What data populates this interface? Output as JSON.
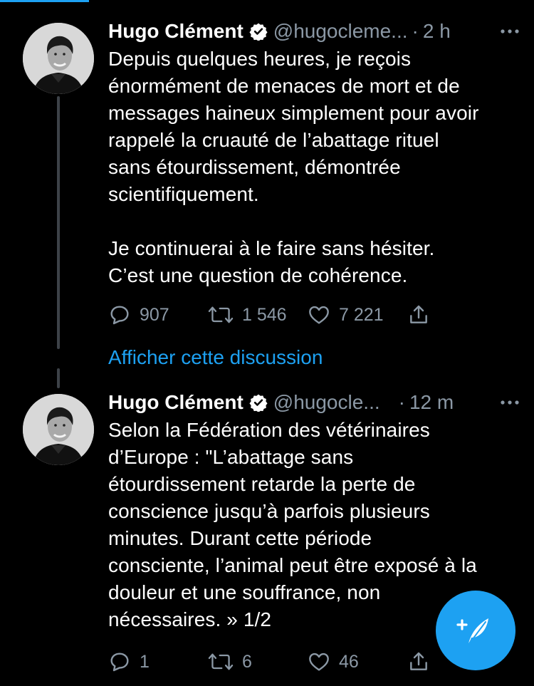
{
  "colors": {
    "background": "#000000",
    "accent": "#1da1f2",
    "secondary_text": "#8b98a5",
    "thread_line": "#3d4248"
  },
  "tweets": [
    {
      "name": "Hugo Clément",
      "verified_icon": "verified-badge-icon",
      "handle": "@hugocleme...",
      "separator": "·",
      "time": "2 h",
      "text": "Depuis quelques heures, je reçois\nénormément de menaces de mort et de\nmessages haineux simplement pour avoir\nrappelé la cruauté de l’abattage rituel\nsans étourdissement, démontrée\nscientifiquement.\n\nJe continuerai à le faire sans hésiter.\nC’est une question de cohérence.",
      "replies": "907",
      "retweets": "1 546",
      "likes": "7 221"
    },
    {
      "name": "Hugo Clément",
      "verified_icon": "verified-badge-icon",
      "handle": "@hugocle...",
      "separator": "·",
      "time": "12 m",
      "text": "Selon la Fédération des vétérinaires\nd’Europe : \"L’abattage sans\nétourdissement retarde la perte de\nconscience jusqu’à parfois plusieurs\nminutes. Durant cette période\nconsciente, l’animal peut être exposé à la\ndouleur et une souffrance, non\nnécessaires. » 1/2",
      "replies": "1",
      "retweets": "6",
      "likes": "46"
    }
  ],
  "show_thread_label": "Afficher cette discussion",
  "fab_icon": "compose-tweet-icon"
}
